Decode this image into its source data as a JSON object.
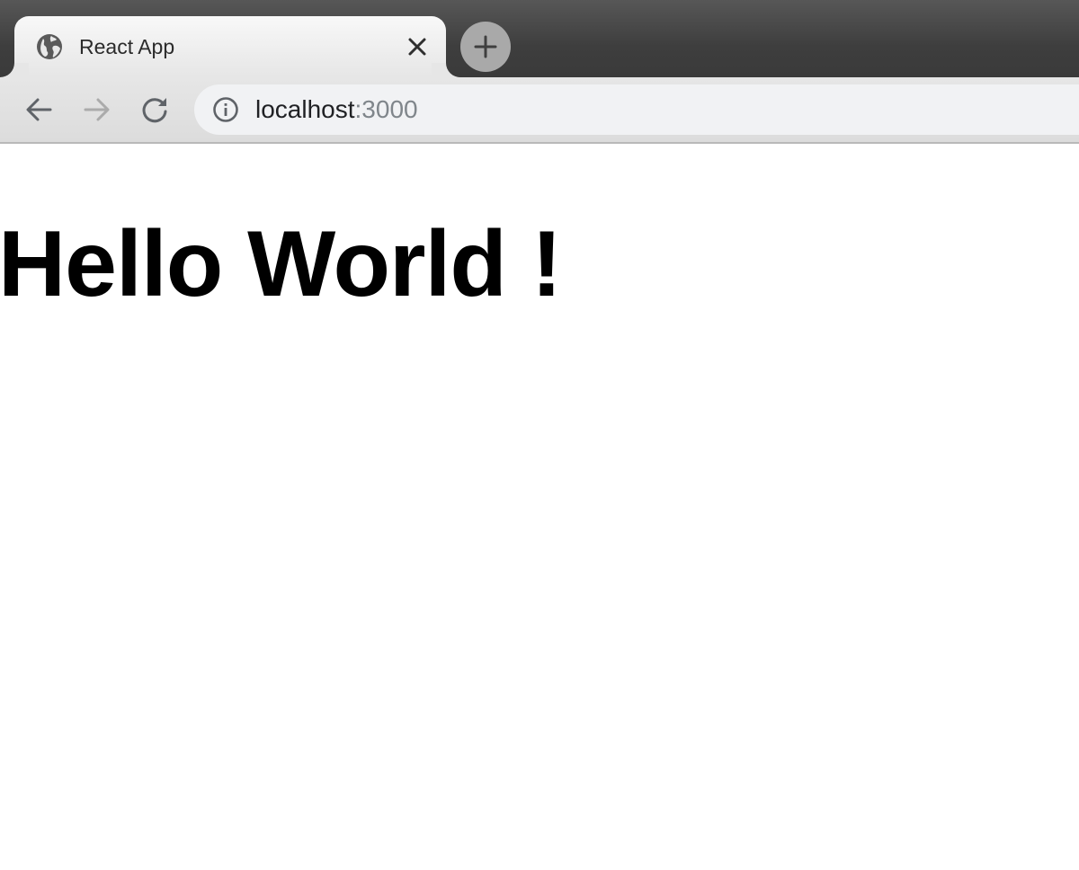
{
  "tab": {
    "title": "React App",
    "favicon": "globe-icon",
    "close_icon": "close-icon"
  },
  "new_tab": {
    "icon": "plus-icon"
  },
  "toolbar": {
    "back_icon": "arrow-left-icon",
    "forward_icon": "arrow-right-icon",
    "reload_icon": "reload-icon",
    "info_icon": "info-icon"
  },
  "address": {
    "host": "localhost",
    "port": ":3000"
  },
  "page": {
    "heading": "Hello World !"
  },
  "colors": {
    "tabstrip": "#3e3e3e",
    "tab_active": "#f1f1f1",
    "omnibox": "#f1f2f4",
    "url_host": "#202124",
    "url_port": "#80868b",
    "heading": "#000000"
  }
}
